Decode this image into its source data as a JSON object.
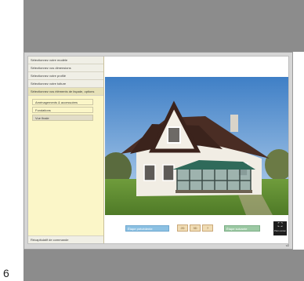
{
  "page_number": "6",
  "sidebar": {
    "items": [
      {
        "label": "Sélectionnez votre modèle"
      },
      {
        "label": "Sélectionnez vos dimensions"
      },
      {
        "label": "Sélectionnez votre profilé"
      },
      {
        "label": "Sélectionnez votre toiture"
      },
      {
        "label": "Sélectionnez vos éléments de façade, options"
      }
    ],
    "sub_items": [
      {
        "label": "Aménagements & accessoires"
      },
      {
        "label": "Fondations"
      },
      {
        "label": "Vue finale"
      }
    ],
    "bottom_label": "Récapitulatif de commande"
  },
  "bottom_bar": {
    "blue_label": "Étape précédente",
    "tan_buttons": [
      "2D",
      "3D",
      "?"
    ],
    "green_label": "Étape suivante",
    "dark_button_label": "Plein écran"
  },
  "status_text": "v2",
  "colors": {
    "sidebar_bg": "#fbf6c8",
    "frame_bg": "#d6d6d6",
    "band_gray": "#8c8c8c",
    "roof_brown": "#4a2d24",
    "glass_green": "#2f6a5a",
    "grass_green": "#5f8f33"
  }
}
